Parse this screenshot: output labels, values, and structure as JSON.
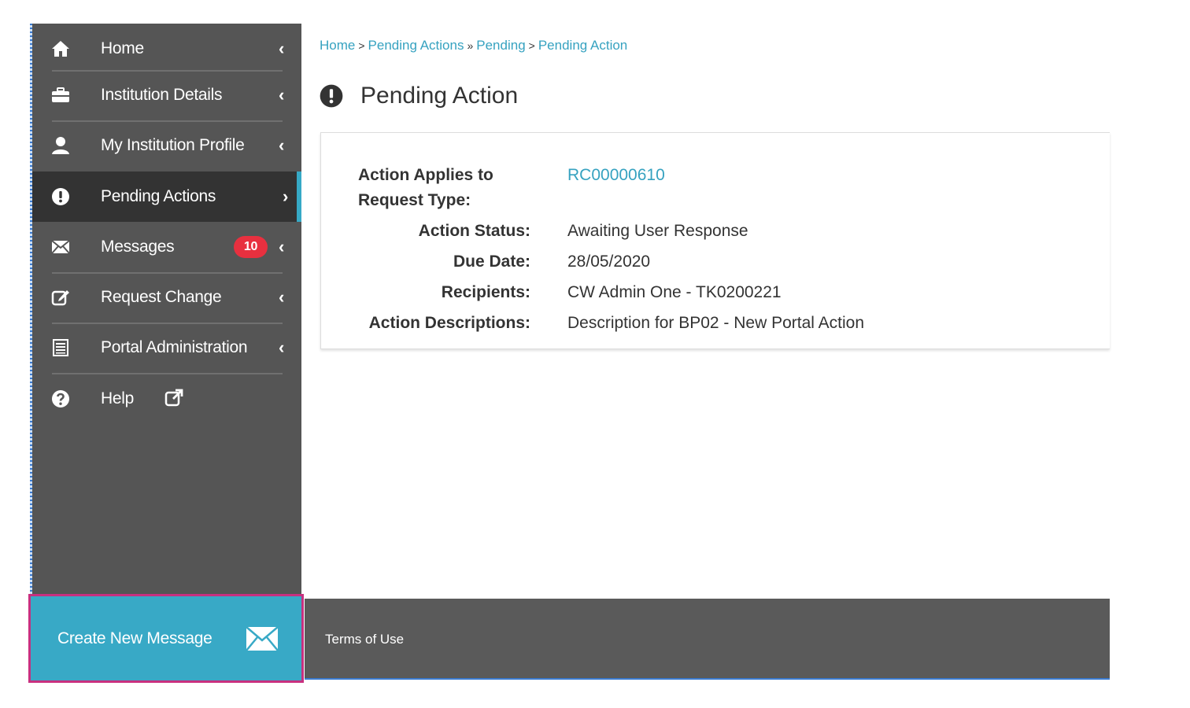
{
  "sidebar": {
    "items": [
      {
        "label": "Home",
        "icon": "home-icon",
        "chevron": "‹"
      },
      {
        "label": "Institution Details",
        "icon": "briefcase-icon",
        "chevron": "‹"
      },
      {
        "label": "My Institution Profile",
        "icon": "user-icon",
        "chevron": "‹"
      },
      {
        "label": "Pending Actions",
        "icon": "exclamation-circle-icon",
        "chevron": "›",
        "active": true
      },
      {
        "label": "Messages",
        "icon": "envelope-icon",
        "chevron": "‹",
        "badge": "10"
      },
      {
        "label": "Request Change",
        "icon": "edit-icon",
        "chevron": "‹"
      },
      {
        "label": "Portal Administration",
        "icon": "list-icon",
        "chevron": "‹"
      },
      {
        "label": "Help",
        "icon": "question-circle-icon",
        "external_icon": "external-link-icon"
      }
    ],
    "create_message": {
      "label": "Create New Message",
      "icon": "envelope-icon"
    }
  },
  "colors": {
    "sidebar_bg": "#555555",
    "active_bg": "#333333",
    "accent": "#36a9c6",
    "badge": "#e8303f",
    "highlight_border": "#c8307f",
    "link": "#36a2c0"
  },
  "breadcrumb": {
    "items": [
      "Home",
      "Pending Actions",
      "Pending",
      "Pending Action"
    ],
    "separators": [
      ">",
      "»",
      ">"
    ]
  },
  "page": {
    "title": "Pending Action",
    "icon": "exclamation-circle-icon"
  },
  "details": {
    "action_applies_label_1": "Action Applies to",
    "action_applies_label_2": "Request Type:",
    "action_applies_value": "RC00000610",
    "status_label": "Action Status:",
    "status_value": "Awaiting User Response",
    "due_label": "Due Date:",
    "due_value": "28/05/2020",
    "recipients_label": "Recipients:",
    "recipients_value": "CW Admin One - TK0200221",
    "descriptions_label": "Action Descriptions:",
    "descriptions_value": "Description for BP02 - New Portal Action"
  },
  "footer": {
    "terms_label": "Terms of Use"
  }
}
